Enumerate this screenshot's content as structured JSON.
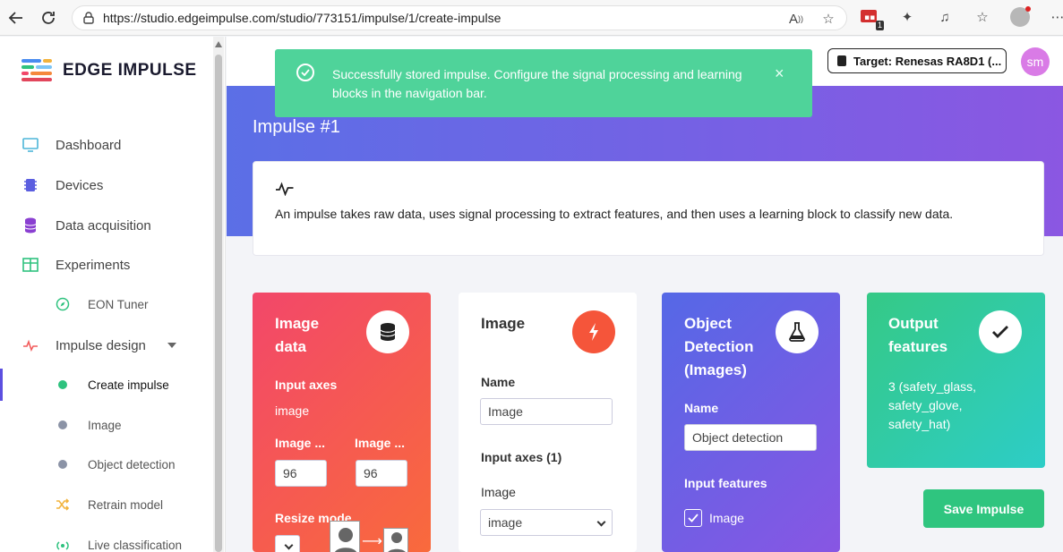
{
  "browser": {
    "url": "https://studio.edgeimpulse.com/studio/773151/impulse/1/create-impulse",
    "extension_badge": "1"
  },
  "sidebar": {
    "logo_text": "EDGE IMPULSE",
    "items": [
      {
        "label": "Dashboard",
        "icon": "monitor-icon"
      },
      {
        "label": "Devices",
        "icon": "chip-icon"
      },
      {
        "label": "Data acquisition",
        "icon": "database-icon"
      },
      {
        "label": "Experiments",
        "icon": "grid-icon"
      },
      {
        "label": "EON Tuner",
        "icon": "compass-icon"
      },
      {
        "label": "Impulse design",
        "icon": "pulse-icon"
      },
      {
        "label": "Create impulse"
      },
      {
        "label": "Image"
      },
      {
        "label": "Object detection"
      },
      {
        "label": "Retrain model",
        "icon": "shuffle-icon"
      },
      {
        "label": "Live classification",
        "icon": "live-icon"
      }
    ]
  },
  "header": {
    "target_label": "Target: Renesas RA8D1 (...",
    "user_initials": "sm"
  },
  "toast": {
    "message": "Successfully stored impulse. Configure the signal processing and learning blocks in the navigation bar.",
    "close": "×"
  },
  "page": {
    "title": "Impulse #1",
    "info_text": "An impulse takes raw data, uses signal processing to extract features, and then uses a learning block to classify new data."
  },
  "blocks": {
    "image_data": {
      "title_line1": "Image",
      "title_line2": "data",
      "input_axes_label": "Input axes",
      "input_axes_value": "image",
      "width_label": "Image ...",
      "height_label": "Image ...",
      "width_value": "96",
      "height_value": "96",
      "resize_label": "Resize mode"
    },
    "image": {
      "title": "Image",
      "name_label": "Name",
      "name_value": "Image",
      "input_axes_label": "Input axes (1)",
      "axis_label": "Image",
      "axis_select": "image"
    },
    "object_detection": {
      "title_line1": "Object",
      "title_line2": "Detection",
      "title_line3": "(Images)",
      "name_label": "Name",
      "name_value": "Object detection",
      "input_features_label": "Input features",
      "feature_item": "Image"
    },
    "output": {
      "title_line1": "Output",
      "title_line2": "features",
      "line1": "3 (safety_glass,",
      "line2": "safety_glove,",
      "line3": "safety_hat)"
    }
  },
  "save_button": "Save Impulse",
  "colors": {
    "accent_green": "#2fc57f",
    "toast_green": "#4fd39a",
    "hero_purple": "#7760e4",
    "image_data_red": "#f2476a",
    "object_detection_blue": "#5568e6",
    "output_teal": "#2dcdc7"
  }
}
